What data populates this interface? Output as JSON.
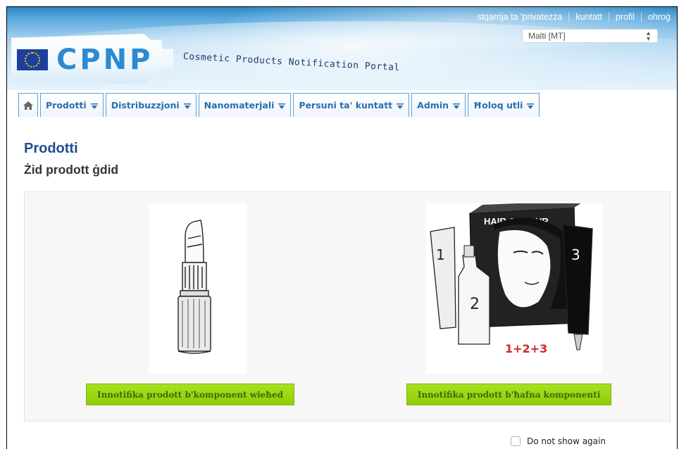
{
  "header": {
    "top_links": [
      "stqarrija ta 'privatezza",
      "kuntatt",
      "profil",
      "ohroġ"
    ],
    "language_selected": "Malti [MT]",
    "logo_text": "CPNP",
    "tagline": "Cosmetic Products Notification Portal"
  },
  "nav": {
    "home_icon": "home-icon",
    "tabs": [
      "Prodotti",
      "Distribuzzjoni",
      "Nanomaterjali",
      "Persuni ta' kuntatt",
      "Admin",
      "Ħoloq utli"
    ]
  },
  "page": {
    "title": "Prodotti",
    "subtitle": "Żid prodott ġdid"
  },
  "options": {
    "single_label": "Innotifika prodott b'komponent wieħed",
    "multi_label": "Innotifika prodott b'ħafna komponenti",
    "hair_box_text": "HAIR COLOUR",
    "hair_numbers": [
      "1",
      "2",
      "3"
    ],
    "hair_formula": "1+2+3"
  },
  "footer": {
    "dont_show_label": "Do not show again"
  },
  "colors": {
    "brand_blue": "#2e8ad0",
    "title_blue": "#1f4e8c",
    "button_green": "#9ad812",
    "tab_text": "#2a6db0",
    "formula_red": "#d3262e"
  }
}
